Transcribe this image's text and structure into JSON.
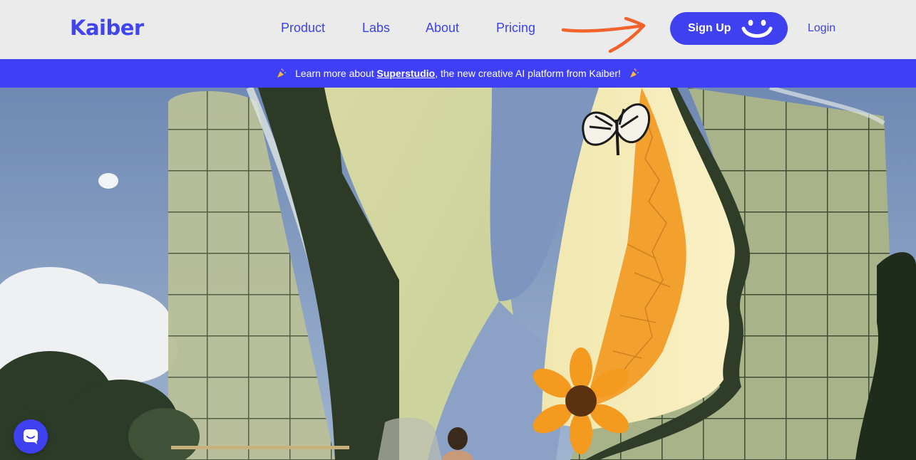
{
  "nav": {
    "logo": "Kaiber",
    "links": [
      {
        "label": "Product"
      },
      {
        "label": "Labs"
      },
      {
        "label": "About"
      },
      {
        "label": "Pricing"
      }
    ],
    "signup_label": "Sign Up",
    "login_label": "Login"
  },
  "banner": {
    "text_before": "Learn more about",
    "link_label": "Superstudio",
    "text_after": ", the new creative AI platform from Kaiber!"
  },
  "colors": {
    "brand_blue": "#3f40f0",
    "banner_blue": "#3f40f5",
    "arrow_orange": "#f2622b"
  },
  "icons": {
    "arrow": "hand-drawn-arrow-icon",
    "smile": "smile-icon",
    "party": "party-popper-icon",
    "chat": "chat-icon"
  }
}
